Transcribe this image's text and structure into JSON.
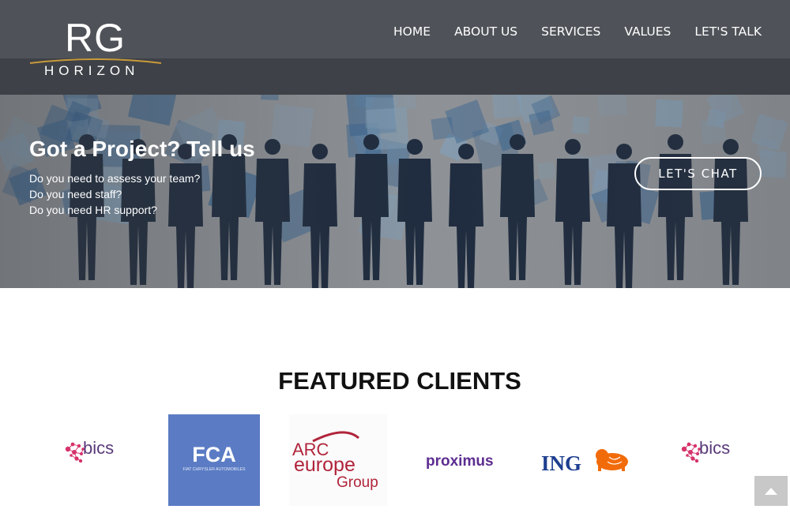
{
  "brand": {
    "logo_top": "RG",
    "logo_bottom": "HORIZON"
  },
  "nav": {
    "items": [
      "HOME",
      "ABOUT US",
      "SERVICES",
      "VALUES",
      "LET'S TALK"
    ]
  },
  "hero": {
    "title": "Got a Project? Tell us",
    "lines": [
      "Do you need to assess your team?",
      "Do you need staff?",
      "Do you need HR support?"
    ],
    "cta_label": "LET'S CHAT"
  },
  "clients": {
    "title": "FEATURED CLIENTS",
    "logos": [
      {
        "name": "bics",
        "text": "bics",
        "color": "#5a3a7a",
        "dot_color": "#d6336c"
      },
      {
        "name": "fca",
        "text": "FCA",
        "subtext": "FIAT CHRYSLER AUTOMOBILES",
        "background": "#5b7cc4"
      },
      {
        "name": "arc-europe",
        "line1": "ARC",
        "line2": "europe",
        "line3": "Group",
        "color": "#b0243a"
      },
      {
        "name": "proximus",
        "text": "proximus",
        "color": "#5c2d91"
      },
      {
        "name": "ing",
        "text": "ING",
        "color": "#1d3f8f",
        "accent": "#f26b0a"
      },
      {
        "name": "bics",
        "text": "bics",
        "color": "#5a3a7a",
        "dot_color": "#d6336c"
      }
    ]
  },
  "colors": {
    "header_top": "#4f5258",
    "header_bottom": "#3e4147",
    "silhouette": "#1b2a3f",
    "tile_blue": "#3b6ea0"
  },
  "icons": {
    "scroll_top": "chevron-up-icon"
  }
}
